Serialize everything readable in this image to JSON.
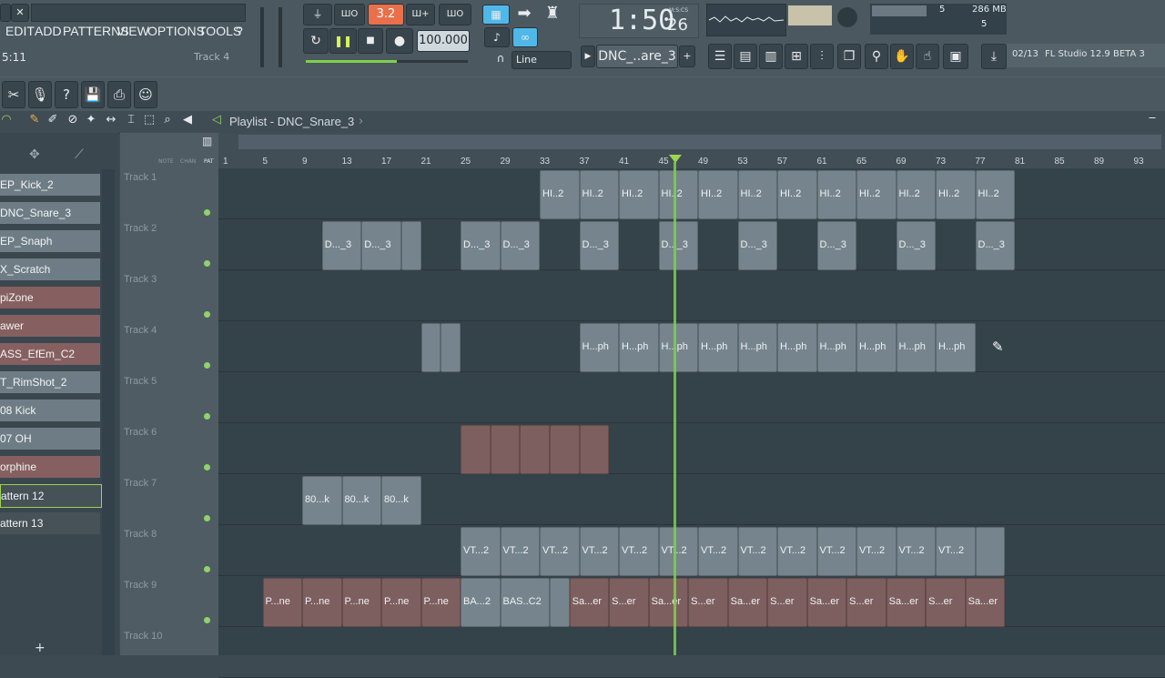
{
  "menu": [
    "EDIT",
    "ADD",
    "PATTERNS",
    "VIEW",
    "OPTIONS",
    "TOOLS",
    "?"
  ],
  "left_status": {
    "time": "5:11",
    "track": "Track 4"
  },
  "transport": {
    "pattern_mode": "3.2",
    "tempo": "100.000",
    "time": "1:50",
    "time_sub": "26",
    "time_unit": "M:S:CS",
    "snap": "Line"
  },
  "pattern_selector": "DNC_..are_3",
  "perf": {
    "mem": "286 MB",
    "cpu": "5",
    "poly": "5"
  },
  "hint": {
    "counter": "02/13",
    "text": "FL Studio 12.9 BETA 3"
  },
  "playlist": {
    "title": "Playlist - DNC_Snare_3",
    "arrow": "›",
    "labels_small": [
      "NOTE",
      "CHAN",
      "PAT"
    ]
  },
  "picker": [
    {
      "label": "EP_Kick_2",
      "kind": "normal"
    },
    {
      "label": "DNC_Snare_3",
      "kind": "normal"
    },
    {
      "label": "EP_Snaph",
      "kind": "normal"
    },
    {
      "label": "X_Scratch",
      "kind": "normal"
    },
    {
      "label": "piZone",
      "kind": "red"
    },
    {
      "label": "awer",
      "kind": "red"
    },
    {
      "label": "ASS_EfEm_C2",
      "kind": "red"
    },
    {
      "label": "T_RimShot_2",
      "kind": "normal"
    },
    {
      "label": "08 Kick",
      "kind": "normal"
    },
    {
      "label": "07 OH",
      "kind": "normal"
    },
    {
      "label": "orphine",
      "kind": "red"
    },
    {
      "label": "attern 12",
      "kind": "pat"
    },
    {
      "label": "attern 13",
      "kind": "pat"
    }
  ],
  "tracks": [
    "Track 1",
    "Track 2",
    "Track 3",
    "Track 4",
    "Track 5",
    "Track 6",
    "Track 7",
    "Track 8",
    "Track 9",
    "Track 10"
  ],
  "ruler": [
    "1",
    "5",
    "9",
    "13",
    "17",
    "21",
    "25",
    "29",
    "33",
    "37",
    "41",
    "45",
    "49",
    "53",
    "57",
    "61",
    "65",
    "69",
    "73",
    "77",
    "81",
    "85",
    "89",
    "93"
  ],
  "clip_labels": {
    "t1": "HI..2",
    "t2": "D..._3",
    "t4": "H...ph",
    "t7": "80...k",
    "t8": "VT...2",
    "t9_pne": "P...ne",
    "t9_ba": "BA...2",
    "t9_bas": "BAS..C2",
    "t9_sa": "Sa...er",
    "t9_s": "S...er"
  },
  "add_symbol": "+"
}
